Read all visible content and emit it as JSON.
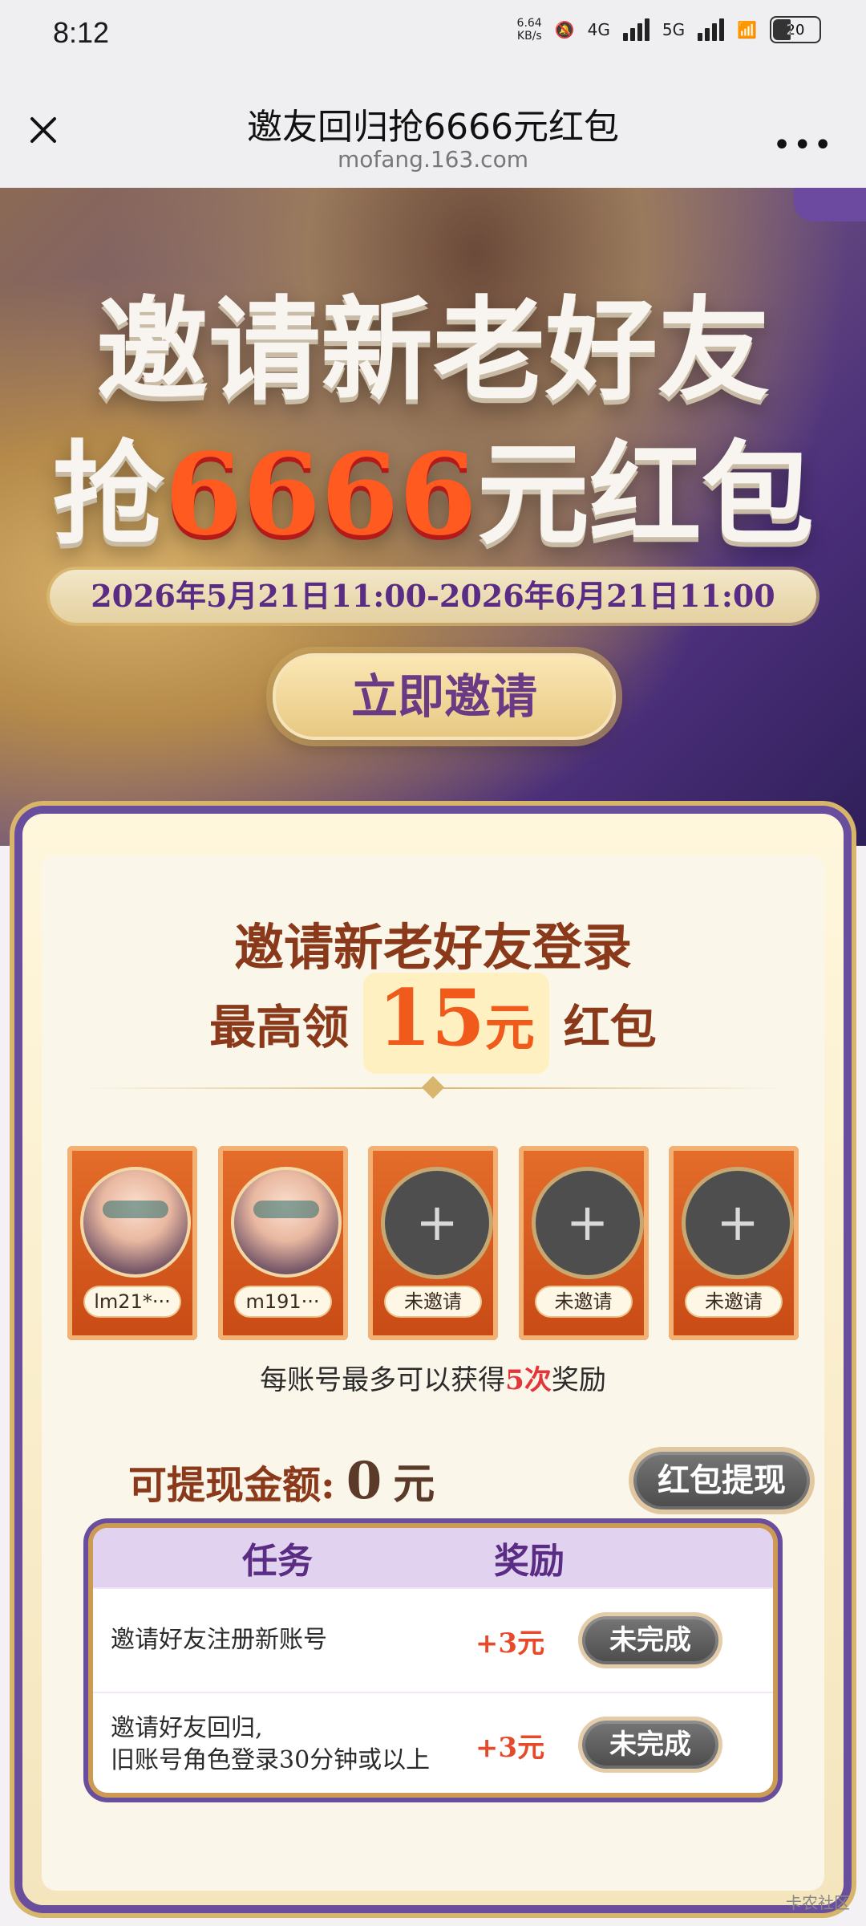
{
  "status_bar": {
    "time": "8:12",
    "network_speed_top": "6.64",
    "network_speed_bottom": "KB/s",
    "signal_4g": "4G",
    "signal_5g": "5G",
    "battery": "20"
  },
  "topbar": {
    "title": "邀友回归抢6666元红包",
    "domain": "mofang.163.com",
    "more": "•••"
  },
  "hero": {
    "line1": "邀请新老好友",
    "line2_prefix": "抢",
    "line2_amount": "6666",
    "line2_suffix": "元红包",
    "date_range": "2026年5月21日11:00-2026年6月21日11:00",
    "cta_label": "立即邀请"
  },
  "panel": {
    "title": "邀请新老好友登录",
    "subtitle_prefix": "最高领",
    "subtitle_amount": "15",
    "subtitle_unit": "元",
    "subtitle_suffix": "红包",
    "slots": [
      {
        "tag": "lm21*···"
      },
      {
        "tag": "m191···"
      },
      {
        "tag": "未邀请"
      },
      {
        "tag": "未邀请"
      },
      {
        "tag": "未邀请"
      }
    ],
    "note_prefix": "每账号最多可以获得",
    "note_highlight": "5次",
    "note_suffix": "奖励",
    "withdraw_label": "可提现金额:",
    "withdraw_amount": "0",
    "withdraw_unit": "元",
    "withdraw_button": "红包提现"
  },
  "tasks": {
    "header_task": "任务",
    "header_reward": "奖励",
    "rows": [
      {
        "text_line1": "邀请好友注册新账号",
        "text_line2": "",
        "reward": "+3元",
        "status": "未完成"
      },
      {
        "text_line1": "邀请好友回归,",
        "text_line2": "旧账号角色登录30分钟或以上",
        "reward": "+3元",
        "status": "未完成"
      }
    ]
  },
  "watermark": "卡农社区"
}
